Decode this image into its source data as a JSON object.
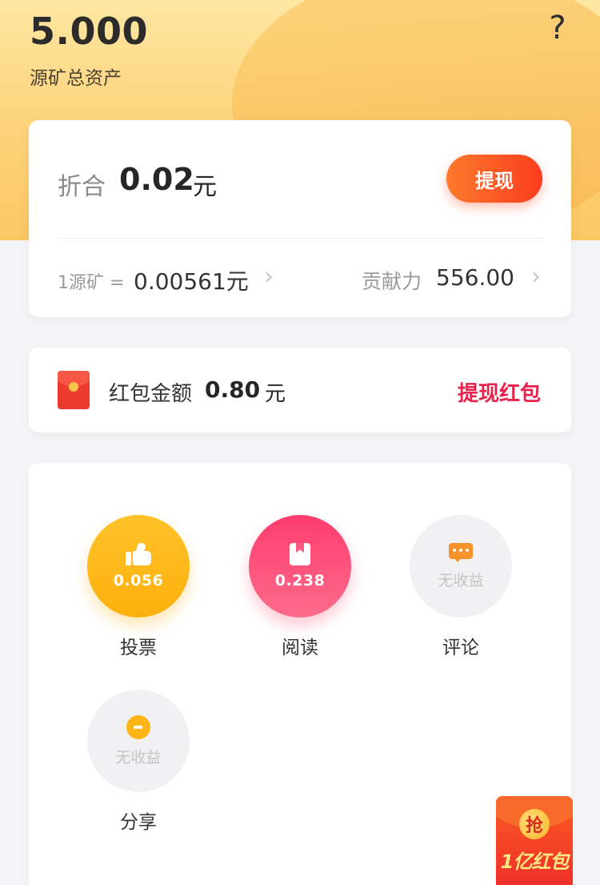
{
  "header": {
    "total_value": "5.000",
    "total_label": "源矿总资产",
    "help_icon": "?"
  },
  "asset_card": {
    "fold_label": "折合",
    "fold_value": "0.02",
    "fold_unit": "元",
    "withdraw_label": "提现",
    "rate_prefix": "1源矿 =",
    "rate_value": "0.00561元",
    "contribution_label": "贡献力",
    "contribution_value": "556.00",
    "chevron": "›"
  },
  "red_packet": {
    "icon": "red-packet-icon",
    "label": "红包金额",
    "value": "0.80",
    "unit": "元",
    "withdraw_label": "提现红包"
  },
  "earnings": [
    {
      "name": "投票",
      "amount": "0.056",
      "icon": "thumbs-up-icon",
      "color": "#fdb00c"
    },
    {
      "name": "阅读",
      "amount": "0.238",
      "icon": "book-icon",
      "color": "#fb4a78"
    },
    {
      "name": "评论",
      "amount": "无收益",
      "icon": "comment-icon",
      "color": "#f1f1f3"
    },
    {
      "name": "分享",
      "amount": "无收益",
      "icon": "share-icon",
      "color": "#f1f1f3"
    }
  ],
  "promo": {
    "coin_text": "抢",
    "text": "1亿红包"
  },
  "colors": {
    "accent_orange": "#fb3d1f",
    "accent_red": "#e8224b",
    "header_gold": "#fdd27a"
  }
}
